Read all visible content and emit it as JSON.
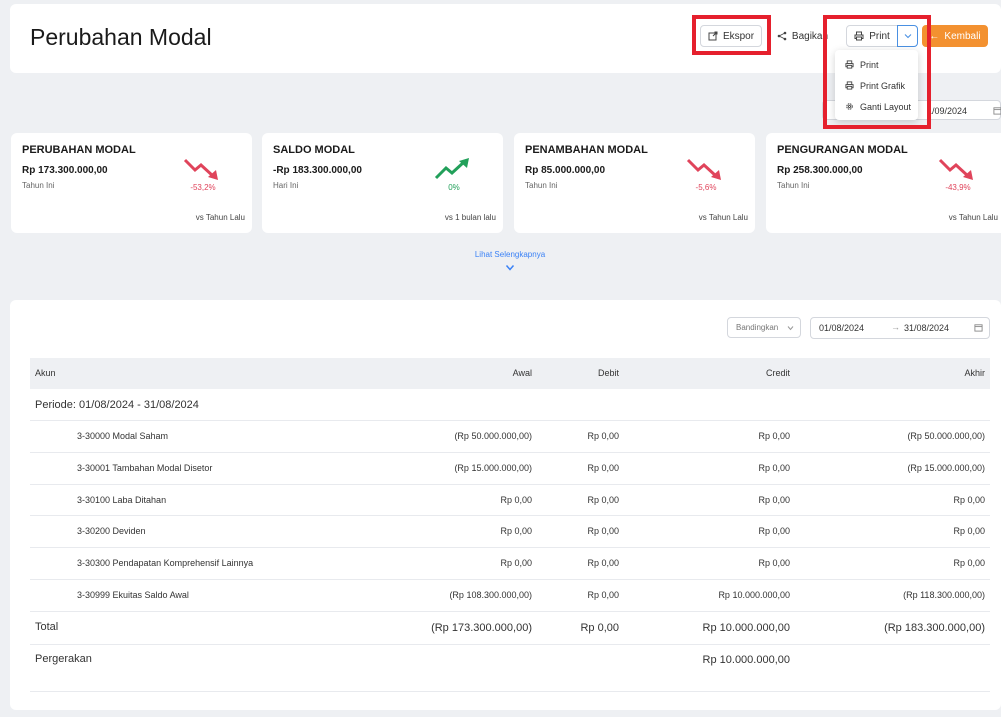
{
  "page": {
    "title": "Perubahan Modal"
  },
  "toolbar": {
    "export_label": "Ekspor",
    "share_label": "Bagikan",
    "print_label": "Print",
    "back_label": "Kembali"
  },
  "print_menu": {
    "items": [
      {
        "label": "Print",
        "icon": "printer-icon"
      },
      {
        "label": "Print Grafik",
        "icon": "printer-icon"
      },
      {
        "label": "Ganti Layout",
        "icon": "gear-icon"
      }
    ]
  },
  "date_peek": {
    "text": "1/09/2024"
  },
  "cards": [
    {
      "title": "PERUBAHAN MODAL",
      "value": "Rp 173.300.000,00",
      "period": "Tahun Ini",
      "change": "-53,2%",
      "trend": "down",
      "compare": "vs Tahun Lalu"
    },
    {
      "title": "SALDO MODAL",
      "value": "-Rp 183.300.000,00",
      "period": "Hari Ini",
      "change": "0%",
      "trend": "up",
      "compare": "vs 1 bulan lalu"
    },
    {
      "title": "PENAMBAHAN MODAL",
      "value": "Rp 85.000.000,00",
      "period": "Tahun Ini",
      "change": "-5,6%",
      "trend": "down",
      "compare": "vs Tahun Lalu"
    },
    {
      "title": "PENGURANGAN MODAL",
      "value": "Rp 258.300.000,00",
      "period": "Tahun Ini",
      "change": "-43,9%",
      "trend": "down",
      "compare": "vs Tahun Lalu"
    }
  ],
  "colors": {
    "negative": "#e0445b",
    "positive": "#22a05a",
    "accent": "#f39130",
    "highlight": "#e5202d"
  },
  "more_link": "Lihat Selengkapnya",
  "filters": {
    "compare_placeholder": "Bandingkan",
    "date_from": "01/08/2024",
    "date_to": "31/08/2024",
    "arrow": "→"
  },
  "table": {
    "headers": {
      "account": "Akun",
      "awal": "Awal",
      "debit": "Debit",
      "credit": "Credit",
      "akhir": "Akhir"
    },
    "period_label": "Periode: 01/08/2024 - 31/08/2024",
    "rows": [
      {
        "account": "3-30000 Modal Saham",
        "awal": "(Rp 50.000.000,00)",
        "debit": "Rp 0,00",
        "credit": "Rp 0,00",
        "akhir": "(Rp 50.000.000,00)"
      },
      {
        "account": "3-30001 Tambahan Modal Disetor",
        "awal": "(Rp 15.000.000,00)",
        "debit": "Rp 0,00",
        "credit": "Rp 0,00",
        "akhir": "(Rp 15.000.000,00)"
      },
      {
        "account": "3-30100 Laba Ditahan",
        "awal": "Rp 0,00",
        "debit": "Rp 0,00",
        "credit": "Rp 0,00",
        "akhir": "Rp 0,00"
      },
      {
        "account": "3-30200 Deviden",
        "awal": "Rp 0,00",
        "debit": "Rp 0,00",
        "credit": "Rp 0,00",
        "akhir": "Rp 0,00"
      },
      {
        "account": "3-30300 Pendapatan Komprehensif Lainnya",
        "awal": "Rp 0,00",
        "debit": "Rp 0,00",
        "credit": "Rp 0,00",
        "akhir": "Rp 0,00"
      },
      {
        "account": "3-30999 Ekuitas Saldo Awal",
        "awal": "(Rp 108.300.000,00)",
        "debit": "Rp 0,00",
        "credit": "Rp 10.000.000,00",
        "akhir": "(Rp 118.300.000,00)"
      }
    ],
    "total": {
      "label": "Total",
      "awal": "(Rp 173.300.000,00)",
      "debit": "Rp 0,00",
      "credit": "Rp 10.000.000,00",
      "akhir": "(Rp 183.300.000,00)"
    },
    "movement": {
      "label": "Pergerakan",
      "credit": "Rp 10.000.000,00"
    }
  }
}
